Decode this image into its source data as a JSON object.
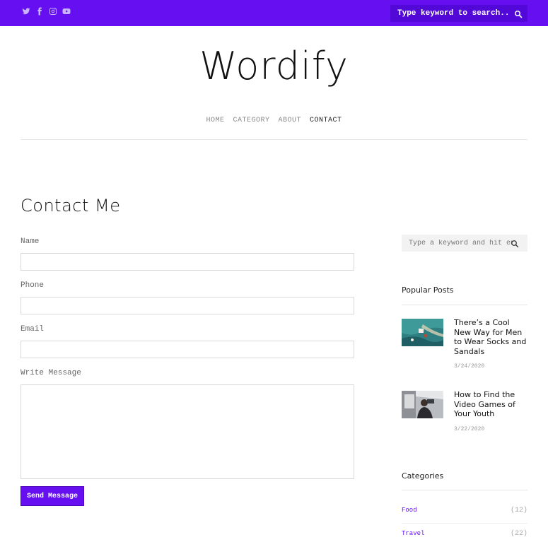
{
  "topbar": {
    "social_icons": [
      "twitter-icon",
      "facebook-icon",
      "instagram-icon",
      "youtube-icon"
    ],
    "search_placeholder": "Type keyword to search...",
    "accent_color": "#6610f2"
  },
  "site": {
    "logo": "Wordify"
  },
  "nav": {
    "items": [
      {
        "label": "HOME"
      },
      {
        "label": "CATEGORY"
      },
      {
        "label": "ABOUT"
      },
      {
        "label": "CONTACT",
        "active": true
      }
    ]
  },
  "contact": {
    "title": "Contact Me",
    "fields": [
      {
        "label": "Name",
        "value": ""
      },
      {
        "label": "Phone",
        "value": ""
      },
      {
        "label": "Email",
        "value": ""
      },
      {
        "label": "Write Message",
        "value": ""
      }
    ],
    "submit_label": "Send Message"
  },
  "sidebar": {
    "search_placeholder": "Type a keyword and hit enter",
    "popular_title": "Popular Posts",
    "posts": [
      {
        "title": "There’s a Cool New Way for Men to Wear Socks and Sandals",
        "date": "3/24/2020"
      },
      {
        "title": "How to Find the Video Games of Your Youth",
        "date": "3/22/2020"
      }
    ],
    "categories_title": "Categories",
    "categories": [
      {
        "name": "Food",
        "count": "(12)"
      },
      {
        "name": "Travel",
        "count": "(22)"
      }
    ]
  }
}
